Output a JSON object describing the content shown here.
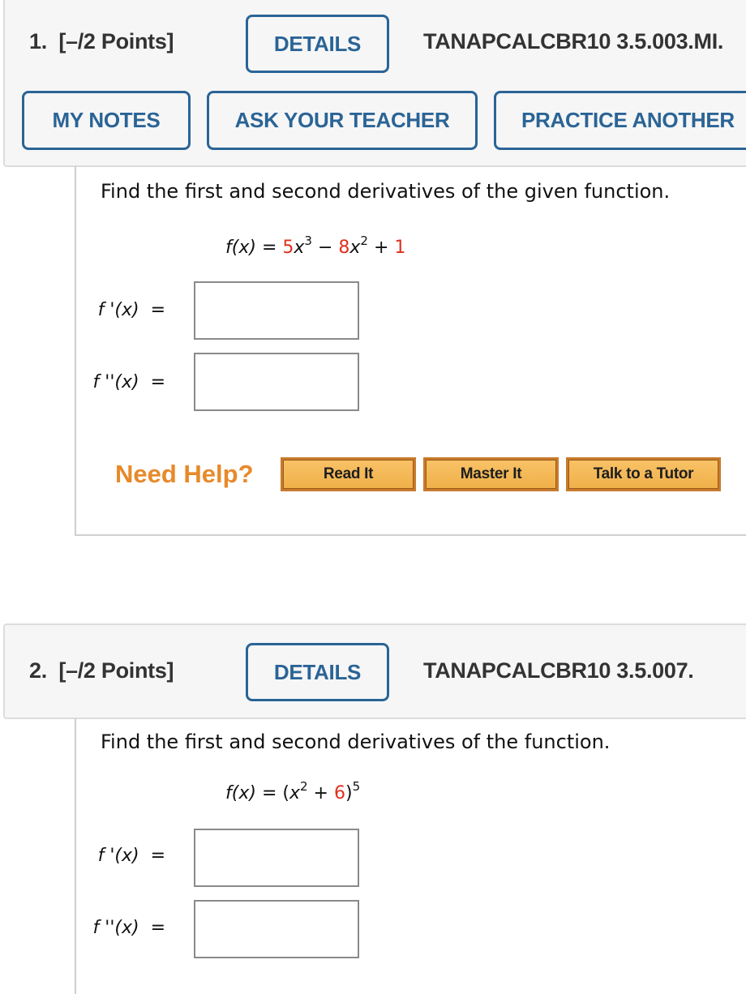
{
  "questions": [
    {
      "number": "1.",
      "points": "[–/2 Points]",
      "details_label": "DETAILS",
      "code": "TANAPCALCBR10 3.5.003.MI.",
      "buttons": {
        "my_notes": "MY NOTES",
        "ask_teacher": "ASK YOUR TEACHER",
        "practice_another": "PRACTICE ANOTHER"
      },
      "prompt": "Find the first and second derivatives of the given function.",
      "formula": {
        "lhs": "f(x)",
        "eq": "=",
        "coef1": "5",
        "var1": "x",
        "exp1": "3",
        "op1": "−",
        "coef2": "8",
        "var2": "x",
        "exp2": "2",
        "op2": "+",
        "const": "1"
      },
      "answers": [
        {
          "label": "f '(x)",
          "eq": "=",
          "value": ""
        },
        {
          "label": "f ''(x)",
          "eq": "=",
          "value": ""
        }
      ],
      "help": {
        "label": "Need Help?",
        "read_it": "Read It",
        "master_it": "Master It",
        "talk_tutor": "Talk to a Tutor"
      }
    },
    {
      "number": "2.",
      "points": "[–/2 Points]",
      "details_label": "DETAILS",
      "code": "TANAPCALCBR10 3.5.007.",
      "prompt": "Find the first and second derivatives of the function.",
      "formula": {
        "lhs": "f(x)",
        "eq": "=",
        "open": "(",
        "var": "x",
        "exp_inner": "2",
        "op": "+",
        "const": "6",
        "close": ")",
        "exp_outer": "5"
      },
      "answers": [
        {
          "label": "f '(x)",
          "eq": "=",
          "value": ""
        },
        {
          "label": "f ''(x)",
          "eq": "=",
          "value": ""
        }
      ]
    }
  ],
  "colors": {
    "accent_blue": "#2a6496",
    "help_orange": "#e8892a",
    "highlight_red": "#e0301e",
    "header_bg": "#f6f6f6"
  }
}
